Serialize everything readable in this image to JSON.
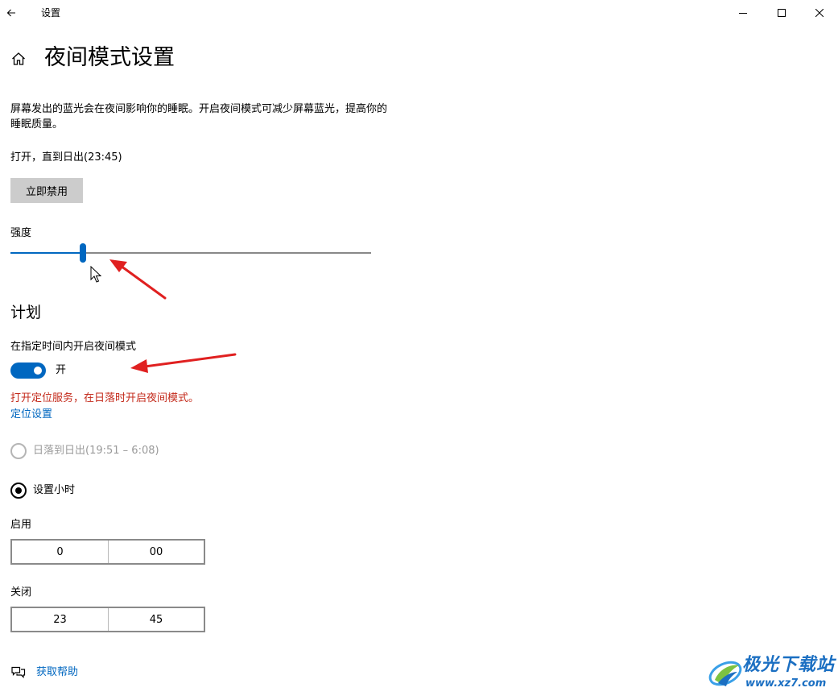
{
  "app": {
    "title": "设置"
  },
  "page": {
    "title": "夜间模式设置"
  },
  "description": "屏幕发出的蓝光会在夜间影响你的睡眠。开启夜间模式可减少屏幕蓝光，提高你的睡眠质量。",
  "status_text": "打开，直到日出(23:45)",
  "disable_button": "立即禁用",
  "strength": {
    "label": "强度",
    "value_fraction": 0.2
  },
  "schedule": {
    "heading": "计划",
    "toggle_label": "在指定时间内开启夜间模式",
    "toggle_state": "开",
    "toggle_on": true,
    "warning": "打开定位服务，在日落时开启夜间模式。",
    "location_link": "定位设置",
    "option_sunset": "日落到日出(19:51 – 6:08)",
    "option_hours": "设置小时",
    "selected": "option_hours"
  },
  "turn_on": {
    "label": "启用",
    "hour": "0",
    "minute": "00"
  },
  "turn_off": {
    "label": "关闭",
    "hour": "23",
    "minute": "45"
  },
  "help": {
    "label": "获取帮助"
  },
  "watermark": {
    "title": "极光下载站",
    "url": "www.xz7.com"
  },
  "colors": {
    "accent": "#0067c0",
    "warning": "#c42b1c",
    "annotation": "#e02020",
    "watermark": "#1b6fc2"
  },
  "icons": {
    "back": "back-arrow-icon",
    "minimize": "minimize-icon",
    "maximize": "maximize-icon",
    "close": "close-icon",
    "home": "home-icon",
    "help": "chat-bubbles-icon"
  }
}
